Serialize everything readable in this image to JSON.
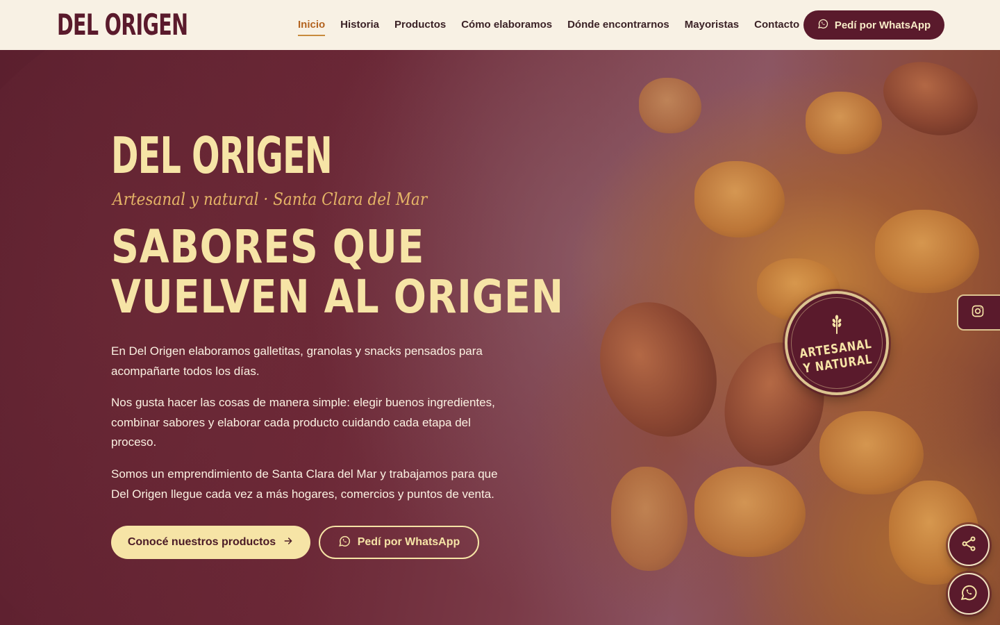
{
  "brand": {
    "logo_text": "DEL ORIGEN"
  },
  "nav": {
    "items": [
      {
        "label": "Inicio",
        "active": true
      },
      {
        "label": "Historia"
      },
      {
        "label": "Productos"
      },
      {
        "label": "Cómo elaboramos"
      },
      {
        "label": "Dónde encontrarnos"
      },
      {
        "label": "Mayoristas"
      },
      {
        "label": "Contacto"
      }
    ],
    "cta_label": "Pedí por WhatsApp",
    "cta_icon": "whatsapp-icon"
  },
  "hero": {
    "title": "DEL ORIGEN",
    "tagline": "Artesanal y natural · Santa Clara del Mar",
    "headline_line1": "SABORES QUE",
    "headline_line2": "VUELVEN AL ORIGEN",
    "paragraphs": [
      "En Del Origen elaboramos galletitas, granolas y snacks pensados para acompañarte todos los días.",
      "Nos gusta hacer las cosas de manera simple: elegir buenos ingredientes, combinar sabores y elaborar cada producto cuidando cada etapa del proceso.",
      "Somos un emprendimiento de Santa Clara del Mar y trabajamos para que Del Origen llegue cada vez a más hogares, comercios y puntos de venta."
    ],
    "primary_button": "Conocé nuestros productos",
    "secondary_button": "Pedí por WhatsApp",
    "badge_line1": "ARTESANAL",
    "badge_line2": "Y NATURAL"
  },
  "floating": {
    "instagram_icon": "instagram-icon",
    "share_icon": "share-icon",
    "whatsapp_icon": "whatsapp-icon"
  },
  "colors": {
    "brand_wine": "#5a1a2c",
    "cream": "#f6e4a6",
    "header_bg": "#f8f1e4",
    "active_nav": "#b3631f",
    "tagline_gold": "#e5b567"
  }
}
